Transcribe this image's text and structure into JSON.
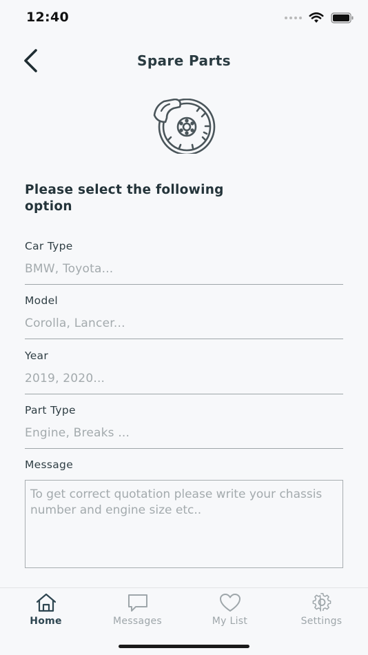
{
  "status_bar": {
    "time": "12:40",
    "icons": [
      "signal-dots-icon",
      "wifi-icon",
      "battery-icon"
    ]
  },
  "nav": {
    "back_icon": "chevron-left-icon",
    "title": "Spare Parts"
  },
  "hero": {
    "icon": "brake-disc-icon"
  },
  "form": {
    "heading": "Please select the following option",
    "fields": [
      {
        "label": "Car Type",
        "placeholder": "BMW, Toyota..."
      },
      {
        "label": "Model",
        "placeholder": "Corolla, Lancer..."
      },
      {
        "label": "Year",
        "placeholder": "2019, 2020..."
      },
      {
        "label": "Part Type",
        "placeholder": "Engine, Breaks ..."
      }
    ],
    "message": {
      "label": "Message",
      "placeholder": "To get correct quotation please write your chassis number and engine size etc.."
    }
  },
  "tab_bar": {
    "active": "Home",
    "tabs": [
      {
        "label": "Home",
        "icon": "home-icon"
      },
      {
        "label": "Messages",
        "icon": "message-icon"
      },
      {
        "label": "My List",
        "icon": "heart-icon"
      },
      {
        "label": "Settings",
        "icon": "gear-icon"
      }
    ]
  },
  "colors": {
    "background": "#f7f8fa",
    "text_primary": "#2a3b41",
    "placeholder": "#a3aaad",
    "tab_active": "#2d4550",
    "tab_inactive": "#9ea6aa"
  }
}
